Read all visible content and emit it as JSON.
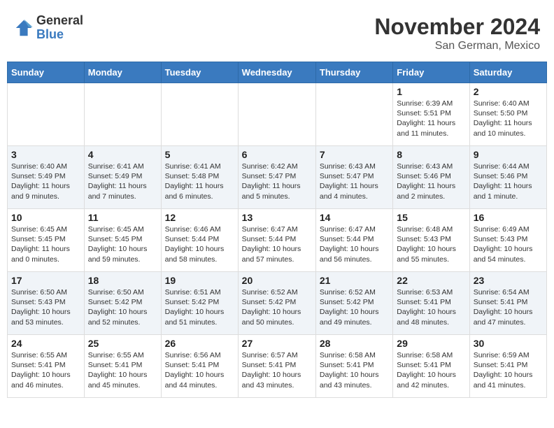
{
  "header": {
    "logo_general": "General",
    "logo_blue": "Blue",
    "month_title": "November 2024",
    "location": "San German, Mexico"
  },
  "days_of_week": [
    "Sunday",
    "Monday",
    "Tuesday",
    "Wednesday",
    "Thursday",
    "Friday",
    "Saturday"
  ],
  "weeks": [
    [
      {
        "day": "",
        "info": ""
      },
      {
        "day": "",
        "info": ""
      },
      {
        "day": "",
        "info": ""
      },
      {
        "day": "",
        "info": ""
      },
      {
        "day": "",
        "info": ""
      },
      {
        "day": "1",
        "info": "Sunrise: 6:39 AM\nSunset: 5:51 PM\nDaylight: 11 hours and 11 minutes."
      },
      {
        "day": "2",
        "info": "Sunrise: 6:40 AM\nSunset: 5:50 PM\nDaylight: 11 hours and 10 minutes."
      }
    ],
    [
      {
        "day": "3",
        "info": "Sunrise: 6:40 AM\nSunset: 5:49 PM\nDaylight: 11 hours and 9 minutes."
      },
      {
        "day": "4",
        "info": "Sunrise: 6:41 AM\nSunset: 5:49 PM\nDaylight: 11 hours and 7 minutes."
      },
      {
        "day": "5",
        "info": "Sunrise: 6:41 AM\nSunset: 5:48 PM\nDaylight: 11 hours and 6 minutes."
      },
      {
        "day": "6",
        "info": "Sunrise: 6:42 AM\nSunset: 5:47 PM\nDaylight: 11 hours and 5 minutes."
      },
      {
        "day": "7",
        "info": "Sunrise: 6:43 AM\nSunset: 5:47 PM\nDaylight: 11 hours and 4 minutes."
      },
      {
        "day": "8",
        "info": "Sunrise: 6:43 AM\nSunset: 5:46 PM\nDaylight: 11 hours and 2 minutes."
      },
      {
        "day": "9",
        "info": "Sunrise: 6:44 AM\nSunset: 5:46 PM\nDaylight: 11 hours and 1 minute."
      }
    ],
    [
      {
        "day": "10",
        "info": "Sunrise: 6:45 AM\nSunset: 5:45 PM\nDaylight: 11 hours and 0 minutes."
      },
      {
        "day": "11",
        "info": "Sunrise: 6:45 AM\nSunset: 5:45 PM\nDaylight: 10 hours and 59 minutes."
      },
      {
        "day": "12",
        "info": "Sunrise: 6:46 AM\nSunset: 5:44 PM\nDaylight: 10 hours and 58 minutes."
      },
      {
        "day": "13",
        "info": "Sunrise: 6:47 AM\nSunset: 5:44 PM\nDaylight: 10 hours and 57 minutes."
      },
      {
        "day": "14",
        "info": "Sunrise: 6:47 AM\nSunset: 5:44 PM\nDaylight: 10 hours and 56 minutes."
      },
      {
        "day": "15",
        "info": "Sunrise: 6:48 AM\nSunset: 5:43 PM\nDaylight: 10 hours and 55 minutes."
      },
      {
        "day": "16",
        "info": "Sunrise: 6:49 AM\nSunset: 5:43 PM\nDaylight: 10 hours and 54 minutes."
      }
    ],
    [
      {
        "day": "17",
        "info": "Sunrise: 6:50 AM\nSunset: 5:43 PM\nDaylight: 10 hours and 53 minutes."
      },
      {
        "day": "18",
        "info": "Sunrise: 6:50 AM\nSunset: 5:42 PM\nDaylight: 10 hours and 52 minutes."
      },
      {
        "day": "19",
        "info": "Sunrise: 6:51 AM\nSunset: 5:42 PM\nDaylight: 10 hours and 51 minutes."
      },
      {
        "day": "20",
        "info": "Sunrise: 6:52 AM\nSunset: 5:42 PM\nDaylight: 10 hours and 50 minutes."
      },
      {
        "day": "21",
        "info": "Sunrise: 6:52 AM\nSunset: 5:42 PM\nDaylight: 10 hours and 49 minutes."
      },
      {
        "day": "22",
        "info": "Sunrise: 6:53 AM\nSunset: 5:41 PM\nDaylight: 10 hours and 48 minutes."
      },
      {
        "day": "23",
        "info": "Sunrise: 6:54 AM\nSunset: 5:41 PM\nDaylight: 10 hours and 47 minutes."
      }
    ],
    [
      {
        "day": "24",
        "info": "Sunrise: 6:55 AM\nSunset: 5:41 PM\nDaylight: 10 hours and 46 minutes."
      },
      {
        "day": "25",
        "info": "Sunrise: 6:55 AM\nSunset: 5:41 PM\nDaylight: 10 hours and 45 minutes."
      },
      {
        "day": "26",
        "info": "Sunrise: 6:56 AM\nSunset: 5:41 PM\nDaylight: 10 hours and 44 minutes."
      },
      {
        "day": "27",
        "info": "Sunrise: 6:57 AM\nSunset: 5:41 PM\nDaylight: 10 hours and 43 minutes."
      },
      {
        "day": "28",
        "info": "Sunrise: 6:58 AM\nSunset: 5:41 PM\nDaylight: 10 hours and 43 minutes."
      },
      {
        "day": "29",
        "info": "Sunrise: 6:58 AM\nSunset: 5:41 PM\nDaylight: 10 hours and 42 minutes."
      },
      {
        "day": "30",
        "info": "Sunrise: 6:59 AM\nSunset: 5:41 PM\nDaylight: 10 hours and 41 minutes."
      }
    ]
  ]
}
